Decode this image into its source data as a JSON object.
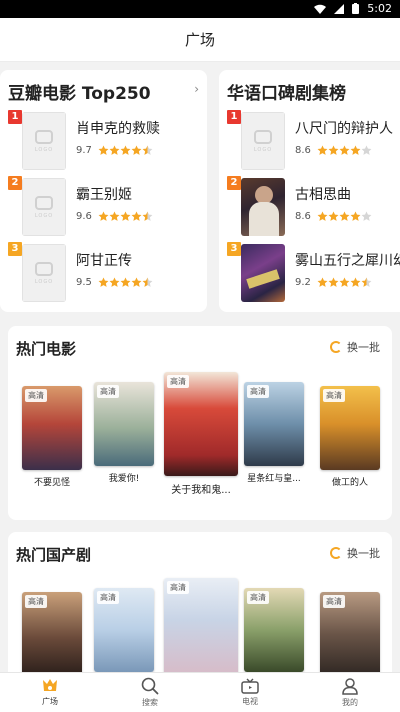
{
  "status": {
    "time": "5:02"
  },
  "header": {
    "title": "广场"
  },
  "rank_lists": [
    {
      "title": "豆瓣电影 Top250",
      "items": [
        {
          "rank": "1",
          "name": "肖申克的救赎",
          "score": "9.7",
          "stars": 4.5
        },
        {
          "rank": "2",
          "name": "霸王别姬",
          "score": "9.6",
          "stars": 4.5
        },
        {
          "rank": "3",
          "name": "阿甘正传",
          "score": "9.5",
          "stars": 4.5
        }
      ]
    },
    {
      "title": "华语口碑剧集榜",
      "items": [
        {
          "rank": "1",
          "name": "八尺门的辩护人",
          "score": "8.6",
          "stars": 4
        },
        {
          "rank": "2",
          "name": "古相思曲",
          "score": "8.6",
          "stars": 4
        },
        {
          "rank": "3",
          "name": "雾山五行之犀川幻",
          "score": "9.2",
          "stars": 4.5
        }
      ]
    }
  ],
  "placeholder_text": "LOGO",
  "hot_movies": {
    "title": "热门电影",
    "refresh_label": "换一批",
    "items": [
      {
        "name": "不要见怪",
        "badge": "高清"
      },
      {
        "name": "我爱你!",
        "badge": "高清"
      },
      {
        "name": "关于我和鬼...",
        "badge": "高清"
      },
      {
        "name": "星条红与皇...",
        "badge": "高清"
      },
      {
        "name": "做工的人",
        "badge": "高清"
      }
    ]
  },
  "hot_dramas": {
    "title": "热门国产剧",
    "refresh_label": "换一批",
    "items": [
      {
        "name": "",
        "badge": "高清"
      },
      {
        "name": "",
        "badge": "高清"
      },
      {
        "name": "",
        "badge": "高清"
      },
      {
        "name": "",
        "badge": "高清"
      },
      {
        "name": "",
        "badge": "高清"
      }
    ]
  },
  "tabs": [
    {
      "label": "广场",
      "icon": "square-icon",
      "active": true
    },
    {
      "label": "搜索",
      "icon": "search-icon",
      "active": false
    },
    {
      "label": "电视",
      "icon": "tv-icon",
      "active": false
    },
    {
      "label": "我的",
      "icon": "profile-icon",
      "active": false
    }
  ],
  "colors": {
    "accent": "#f5a623",
    "star": "#f5a623",
    "badge1": "#e8382f",
    "badge2": "#f57c1f",
    "badge3": "#f5a623"
  }
}
